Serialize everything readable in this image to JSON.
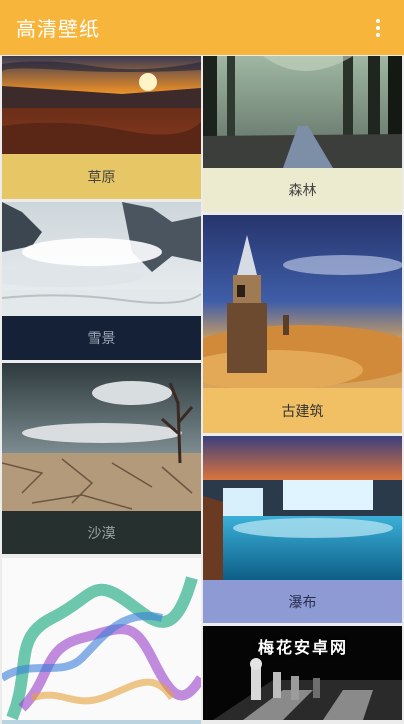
{
  "app": {
    "title": "高清壁纸"
  },
  "cards": {
    "grassland": "草原",
    "forest": "森林",
    "snow": "雪景",
    "ancient": "古建筑",
    "desert": "沙漠",
    "waterfall": "瀑布"
  },
  "watermark": "梅花安卓网"
}
